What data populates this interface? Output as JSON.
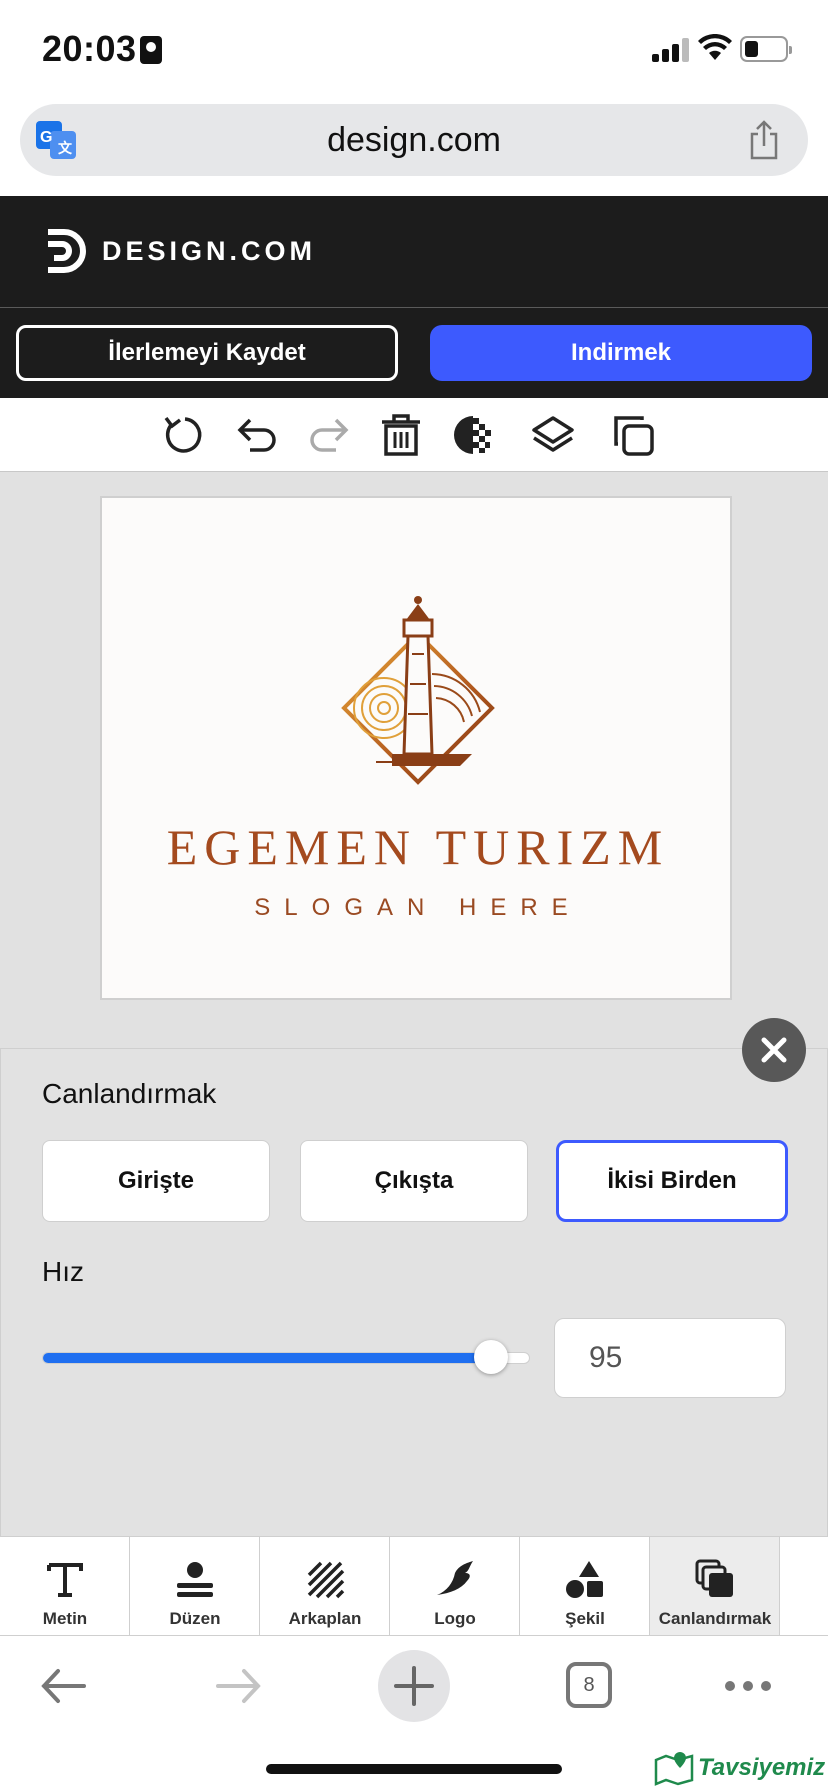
{
  "status_bar": {
    "time": "20:03"
  },
  "browser": {
    "url": "design.com",
    "tab_count": "8"
  },
  "app": {
    "brand": "DESIGN.COM",
    "save_label": "İlerlemeyi Kaydet",
    "download_label": "Indirmek"
  },
  "toolbar": {
    "icons": [
      "reset-icon",
      "undo-icon",
      "redo-icon",
      "delete-icon",
      "transparency-icon",
      "layers-icon",
      "duplicate-icon"
    ]
  },
  "design": {
    "company_name": "EGEMEN TURIZM",
    "slogan": "SLOGAN HERE",
    "brand_color": "#a44a1e"
  },
  "animation_panel": {
    "title": "Canlandırmak",
    "options": [
      {
        "label": "Girişte",
        "selected": false
      },
      {
        "label": "Çıkışta",
        "selected": false
      },
      {
        "label": "İkisi Birden",
        "selected": true
      }
    ],
    "speed_label": "Hız",
    "speed_value": "95",
    "speed_fraction": 0.92,
    "accent_color": "#3d5afe"
  },
  "bottom_tools": [
    {
      "label": "Metin",
      "icon": "text-icon",
      "active": false
    },
    {
      "label": "Düzen",
      "icon": "layout-icon",
      "active": false
    },
    {
      "label": "Arkaplan",
      "icon": "background-icon",
      "active": false
    },
    {
      "label": "Logo",
      "icon": "logo-icon",
      "active": false
    },
    {
      "label": "Şekil",
      "icon": "shapes-icon",
      "active": false
    },
    {
      "label": "Canlandırmak",
      "icon": "animate-icon",
      "active": true
    }
  ],
  "watermark": "Tavsiyemiz"
}
